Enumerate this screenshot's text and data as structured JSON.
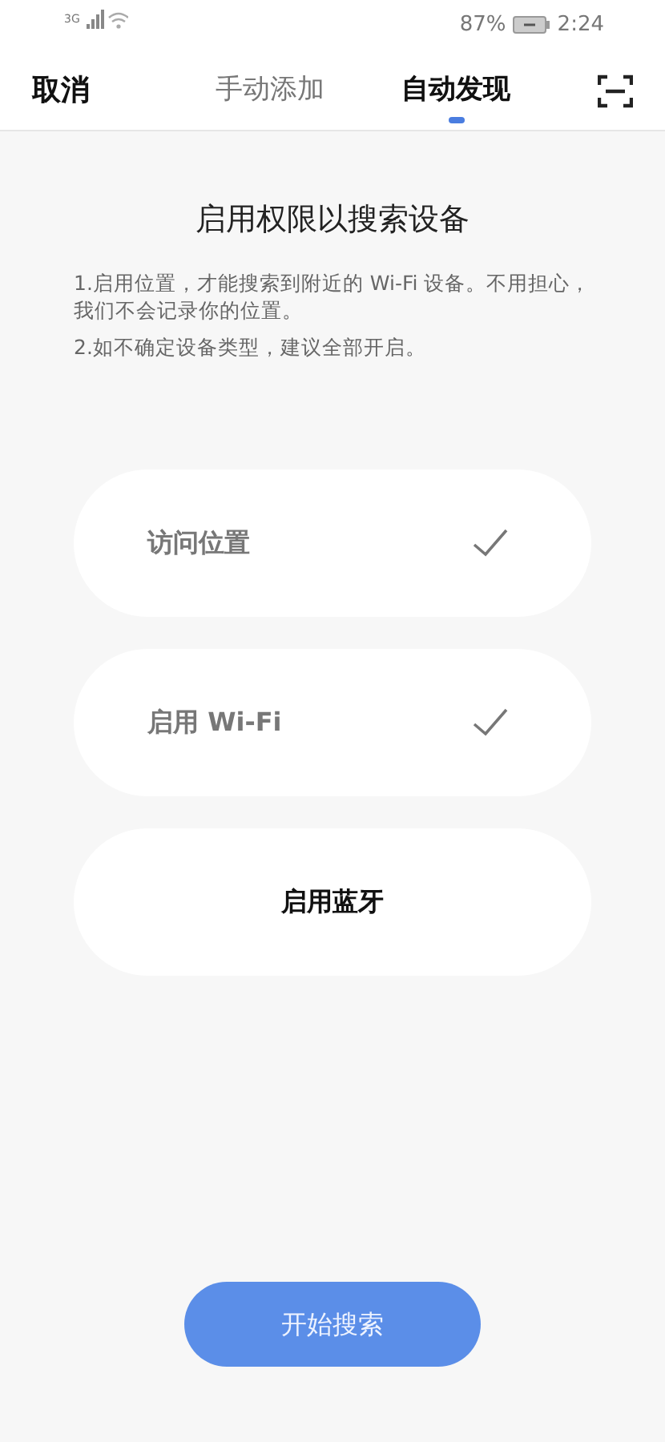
{
  "status_bar": {
    "network": "3G",
    "battery": "87%",
    "time": "2:24"
  },
  "header": {
    "cancel": "取消",
    "tabs": [
      {
        "label": "手动添加",
        "selected": false
      },
      {
        "label": "自动发现",
        "selected": true
      }
    ]
  },
  "title": "启用权限以搜索设备",
  "notes": [
    "1.启用位置，才能搜索到附近的 Wi-Fi 设备。不用担心，我们不会记录你的位置。",
    "2.如不确定设备类型，建议全部开启。"
  ],
  "permissions": [
    {
      "label": "访问位置",
      "checked": true
    },
    {
      "label": "启用 Wi-Fi",
      "checked": true
    },
    {
      "label": "启用蓝牙",
      "checked": false
    }
  ],
  "start_button": "开始搜索"
}
